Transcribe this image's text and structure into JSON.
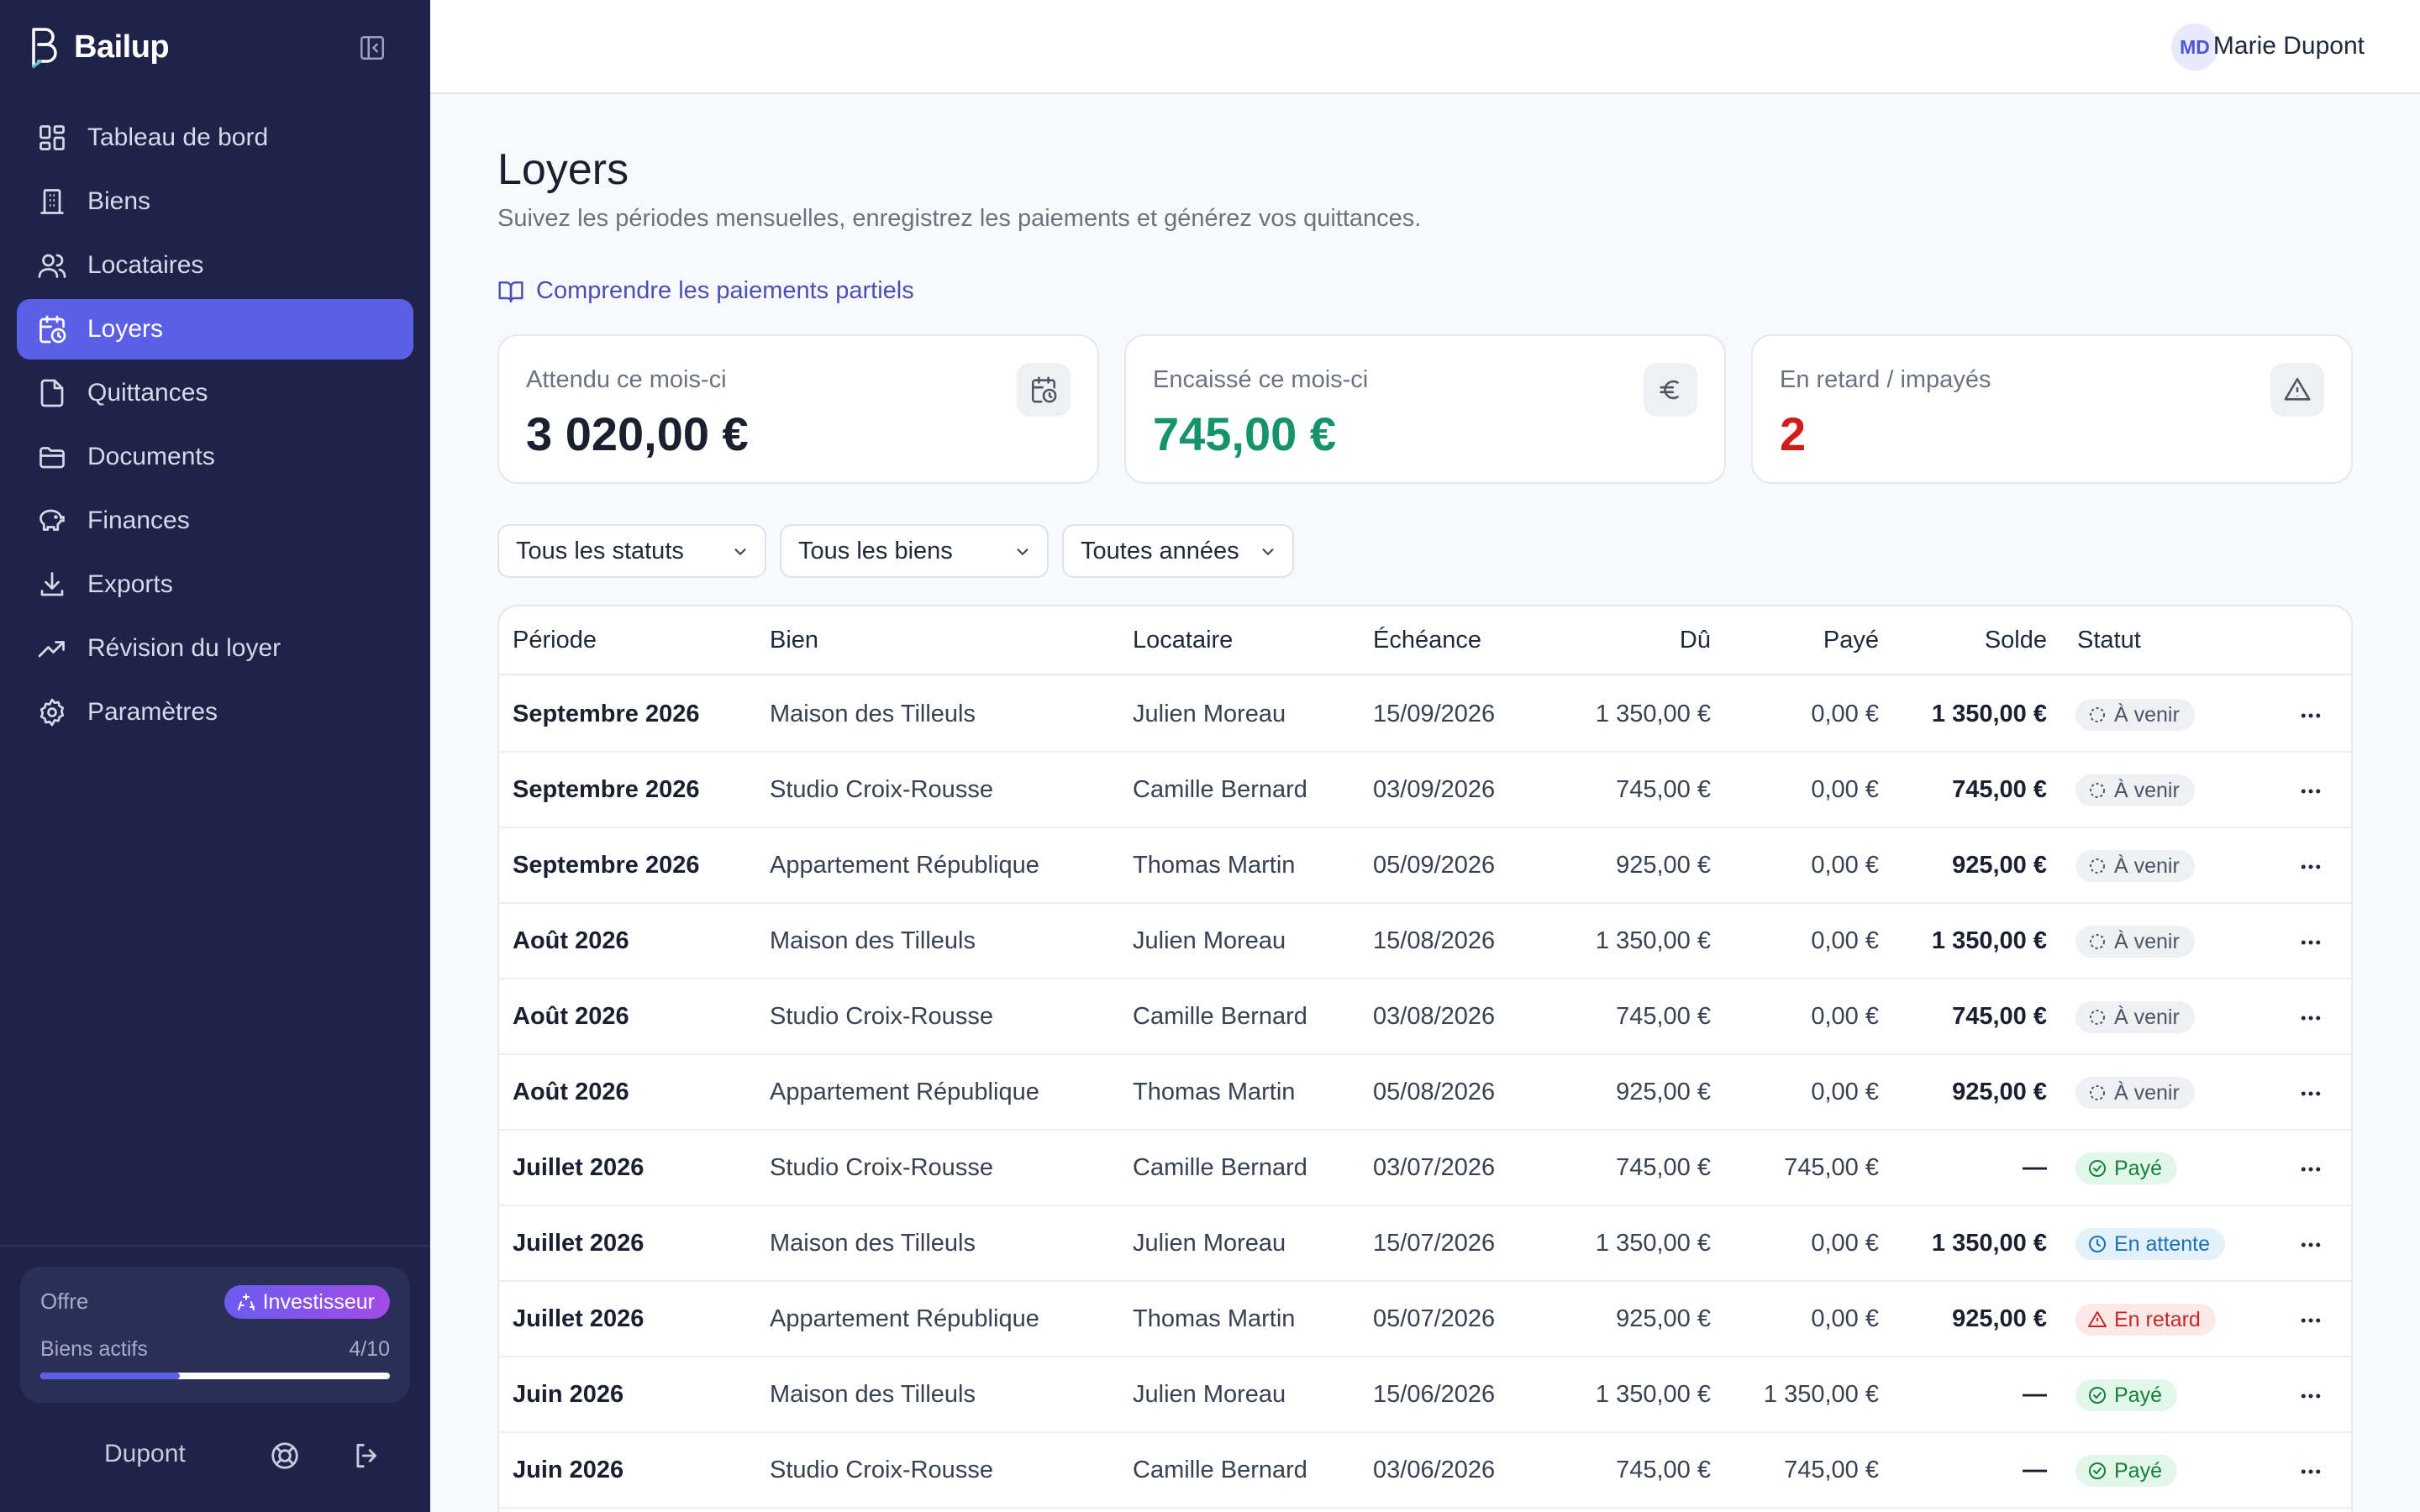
{
  "app": {
    "name": "Bailup"
  },
  "sidebar": {
    "items": [
      {
        "label": "Tableau de bord",
        "icon": "dashboard-icon"
      },
      {
        "label": "Biens",
        "icon": "building-icon"
      },
      {
        "label": "Locataires",
        "icon": "users-icon"
      },
      {
        "label": "Loyers",
        "icon": "calendar-clock-icon",
        "active": true
      },
      {
        "label": "Quittances",
        "icon": "receipt-icon"
      },
      {
        "label": "Documents",
        "icon": "folder-icon"
      },
      {
        "label": "Finances",
        "icon": "piggy-bank-icon"
      },
      {
        "label": "Exports",
        "icon": "download-icon"
      },
      {
        "label": "Révision du loyer",
        "icon": "trending-up-icon"
      },
      {
        "label": "Paramètres",
        "icon": "gear-icon"
      }
    ],
    "plan": {
      "label": "Offre",
      "badge": "Investisseur",
      "assets_label": "Biens actifs",
      "assets_count": "4/10",
      "assets_fraction": 0.4
    },
    "footer": {
      "user": "Dupont"
    }
  },
  "header": {
    "avatar_initials": "MD",
    "user_name": "Marie Dupont"
  },
  "page": {
    "title": "Loyers",
    "subtitle": "Suivez les périodes mensuelles, enregistrez les paiements et générez vos quittances.",
    "help_link": "Comprendre les paiements partiels"
  },
  "stats": [
    {
      "label": "Attendu ce mois-ci",
      "value": "3 020,00 €",
      "color": "#1a2030",
      "icon": "calendar-clock-icon"
    },
    {
      "label": "Encaissé ce mois-ci",
      "value": "745,00 €",
      "color": "#15936b",
      "icon": "euro-icon"
    },
    {
      "label": "En retard / impayés",
      "value": "2",
      "color": "#d41b1b",
      "icon": "warning-icon"
    }
  ],
  "filters": {
    "status": "Tous les statuts",
    "property": "Tous les biens",
    "year": "Toutes années"
  },
  "table": {
    "headers": {
      "period": "Période",
      "property": "Bien",
      "tenant": "Locataire",
      "due_date": "Échéance",
      "amount": "Dû",
      "paid": "Payé",
      "balance": "Solde",
      "status": "Statut"
    },
    "rows": [
      {
        "period": "Septembre 2026",
        "property": "Maison des Tilleuls",
        "tenant": "Julien Moreau",
        "due_date": "15/09/2026",
        "amount": "1 350,00 €",
        "paid": "0,00 €",
        "balance": "1 350,00 €",
        "status": "À venir",
        "status_type": "upcoming"
      },
      {
        "period": "Septembre 2026",
        "property": "Studio Croix-Rousse",
        "tenant": "Camille Bernard",
        "due_date": "03/09/2026",
        "amount": "745,00 €",
        "paid": "0,00 €",
        "balance": "745,00 €",
        "status": "À venir",
        "status_type": "upcoming"
      },
      {
        "period": "Septembre 2026",
        "property": "Appartement République",
        "tenant": "Thomas Martin",
        "due_date": "05/09/2026",
        "amount": "925,00 €",
        "paid": "0,00 €",
        "balance": "925,00 €",
        "status": "À venir",
        "status_type": "upcoming"
      },
      {
        "period": "Août 2026",
        "property": "Maison des Tilleuls",
        "tenant": "Julien Moreau",
        "due_date": "15/08/2026",
        "amount": "1 350,00 €",
        "paid": "0,00 €",
        "balance": "1 350,00 €",
        "status": "À venir",
        "status_type": "upcoming"
      },
      {
        "period": "Août 2026",
        "property": "Studio Croix-Rousse",
        "tenant": "Camille Bernard",
        "due_date": "03/08/2026",
        "amount": "745,00 €",
        "paid": "0,00 €",
        "balance": "745,00 €",
        "status": "À venir",
        "status_type": "upcoming"
      },
      {
        "period": "Août 2026",
        "property": "Appartement République",
        "tenant": "Thomas Martin",
        "due_date": "05/08/2026",
        "amount": "925,00 €",
        "paid": "0,00 €",
        "balance": "925,00 €",
        "status": "À venir",
        "status_type": "upcoming"
      },
      {
        "period": "Juillet 2026",
        "property": "Studio Croix-Rousse",
        "tenant": "Camille Bernard",
        "due_date": "03/07/2026",
        "amount": "745,00 €",
        "paid": "745,00 €",
        "balance": "—",
        "status": "Payé",
        "status_type": "paid"
      },
      {
        "period": "Juillet 2026",
        "property": "Maison des Tilleuls",
        "tenant": "Julien Moreau",
        "due_date": "15/07/2026",
        "amount": "1 350,00 €",
        "paid": "0,00 €",
        "balance": "1 350,00 €",
        "status": "En attente",
        "status_type": "pending"
      },
      {
        "period": "Juillet 2026",
        "property": "Appartement République",
        "tenant": "Thomas Martin",
        "due_date": "05/07/2026",
        "amount": "925,00 €",
        "paid": "0,00 €",
        "balance": "925,00 €",
        "status": "En retard",
        "status_type": "late"
      },
      {
        "period": "Juin 2026",
        "property": "Maison des Tilleuls",
        "tenant": "Julien Moreau",
        "due_date": "15/06/2026",
        "amount": "1 350,00 €",
        "paid": "1 350,00 €",
        "balance": "—",
        "status": "Payé",
        "status_type": "paid"
      },
      {
        "period": "Juin 2026",
        "property": "Studio Croix-Rousse",
        "tenant": "Camille Bernard",
        "due_date": "03/06/2026",
        "amount": "745,00 €",
        "paid": "745,00 €",
        "balance": "—",
        "status": "Payé",
        "status_type": "paid"
      }
    ]
  }
}
